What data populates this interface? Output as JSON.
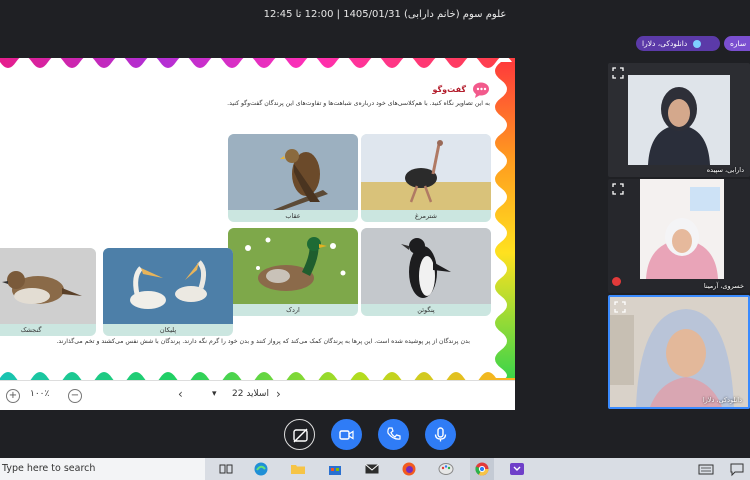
{
  "meeting": {
    "title": "علوم سوم (خانم دارابی) 1405/01/31 | 12:00 تا 12:45"
  },
  "chips": {
    "presenter": "دانلودکی، دلارا",
    "other": "ساره"
  },
  "slide": {
    "lesson_title": "گفت‌وگو",
    "instruction": "به این تصاویر نگاه کنید. با هم‌کلاسی‌های خود درباره‌ی شباهت‌ها و تفاوت‌های این پرندگان گفت‌وگو کنید.",
    "birds": [
      {
        "label": "عقاب",
        "kind": "eagle"
      },
      {
        "label": "شترمرغ",
        "kind": "ostrich"
      },
      {
        "label": "اردک",
        "kind": "duck"
      },
      {
        "label": "پنگوئن",
        "kind": "penguin"
      },
      {
        "label": "گنجشک",
        "kind": "sparrow"
      },
      {
        "label": "پلیکان",
        "kind": "pelican"
      }
    ],
    "bottom_text": "بدن پرندگان از پر پوشیده شده است. این پرها به پرندگان کمک می‌کند که پرواز کنند و بدن خود را گرم نگه دارند. پرندگان با شش نفس می‌کشند و تخم می‌گذارند."
  },
  "viewer": {
    "zoom": "۱۰۰٪",
    "slide_label": "اسلاید 22"
  },
  "participants": [
    {
      "name": "دارابی، سپیده",
      "kind": "teacher"
    },
    {
      "name": "خسروی، آرمینا",
      "kind": "student-a"
    },
    {
      "name": "دانلودکی، دلارا",
      "kind": "student-b"
    }
  ],
  "taskbar": {
    "search_placeholder": "Type here to search"
  },
  "colors": {
    "accent": "#2f7cf6",
    "chip": "#5b3aa8",
    "caption_bg": "#cbe6e0"
  }
}
